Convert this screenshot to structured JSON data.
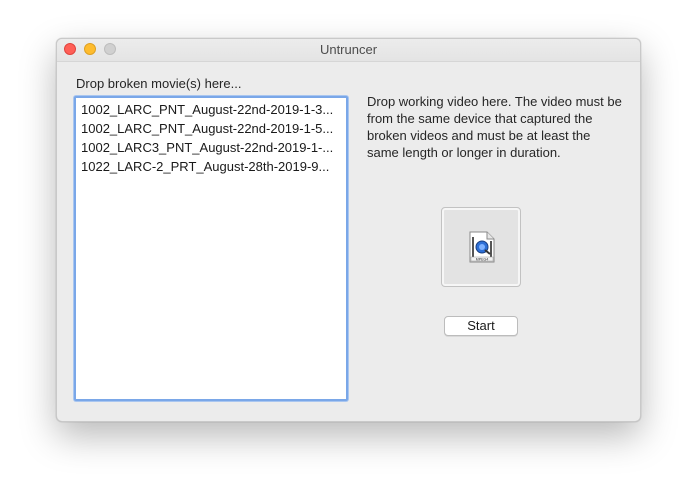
{
  "window": {
    "title": "Untruncer"
  },
  "broken_panel": {
    "label": "Drop broken movie(s) here...",
    "files": [
      "1002_LARC_PNT_August-22nd-2019-1-3...",
      "1002_LARC_PNT_August-22nd-2019-1-5...",
      "1002_LARC3_PNT_August-22nd-2019-1-...",
      "1022_LARC-2_PRT_August-28th-2019-9..."
    ]
  },
  "working_panel": {
    "instructions": "Drop working video here. The video must be from the same device that captured the broken videos and must be at least the same length or longer in duration.",
    "icon": "mpeg4-movie-file-icon",
    "icon_badge": "MPEG4"
  },
  "actions": {
    "start_label": "Start"
  },
  "colors": {
    "close": "#ff5f57",
    "minimize": "#febc2e",
    "zoom_disabled": "#d0d0d0",
    "focus_ring": "#7aa7e8"
  }
}
